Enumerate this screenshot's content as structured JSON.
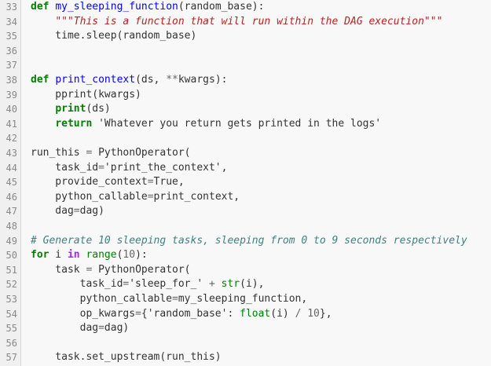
{
  "editor": {
    "lines": [
      {
        "num": "33",
        "tokens": [
          {
            "t": "k",
            "v": "def"
          },
          {
            "t": "t",
            "v": " "
          },
          {
            "t": "nf",
            "v": "my_sleeping_function"
          },
          {
            "t": "t",
            "v": "(random_base):"
          }
        ]
      },
      {
        "num": "34",
        "tokens": [
          {
            "t": "t",
            "v": "    "
          },
          {
            "t": "sd",
            "v": "\"\"\"This is a function that will run within the DAG execution\"\"\""
          }
        ]
      },
      {
        "num": "35",
        "tokens": [
          {
            "t": "t",
            "v": "    time.sleep(random_base)"
          }
        ]
      },
      {
        "num": "36",
        "tokens": []
      },
      {
        "num": "37",
        "tokens": []
      },
      {
        "num": "38",
        "tokens": [
          {
            "t": "k",
            "v": "def"
          },
          {
            "t": "t",
            "v": " "
          },
          {
            "t": "nf",
            "v": "print_context"
          },
          {
            "t": "t",
            "v": "(ds, "
          },
          {
            "t": "o",
            "v": "**"
          },
          {
            "t": "t",
            "v": "kwargs):"
          }
        ]
      },
      {
        "num": "39",
        "tokens": [
          {
            "t": "t",
            "v": "    pprint(kwargs)"
          }
        ]
      },
      {
        "num": "40",
        "tokens": [
          {
            "t": "t",
            "v": "    "
          },
          {
            "t": "k",
            "v": "print"
          },
          {
            "t": "t",
            "v": "(ds)"
          }
        ]
      },
      {
        "num": "41",
        "tokens": [
          {
            "t": "t",
            "v": "    "
          },
          {
            "t": "k",
            "v": "return"
          },
          {
            "t": "t",
            "v": " 'Whatever you return gets printed in the logs'"
          }
        ]
      },
      {
        "num": "42",
        "tokens": []
      },
      {
        "num": "43",
        "tokens": [
          {
            "t": "t",
            "v": "run_this "
          },
          {
            "t": "o",
            "v": "="
          },
          {
            "t": "t",
            "v": " PythonOperator("
          }
        ]
      },
      {
        "num": "44",
        "tokens": [
          {
            "t": "t",
            "v": "    task_id"
          },
          {
            "t": "o",
            "v": "="
          },
          {
            "t": "t",
            "v": "'print_the_context',"
          }
        ]
      },
      {
        "num": "45",
        "tokens": [
          {
            "t": "t",
            "v": "    provide_context"
          },
          {
            "t": "o",
            "v": "="
          },
          {
            "t": "t",
            "v": "True,"
          }
        ]
      },
      {
        "num": "46",
        "tokens": [
          {
            "t": "t",
            "v": "    python_callable"
          },
          {
            "t": "o",
            "v": "="
          },
          {
            "t": "t",
            "v": "print_context,"
          }
        ]
      },
      {
        "num": "47",
        "tokens": [
          {
            "t": "t",
            "v": "    dag"
          },
          {
            "t": "o",
            "v": "="
          },
          {
            "t": "t",
            "v": "dag)"
          }
        ]
      },
      {
        "num": "48",
        "tokens": []
      },
      {
        "num": "49",
        "tokens": [
          {
            "t": "c",
            "v": "# Generate 10 sleeping tasks, sleeping from 0 to 9 seconds respectively"
          }
        ]
      },
      {
        "num": "50",
        "tokens": [
          {
            "t": "k",
            "v": "for"
          },
          {
            "t": "t",
            "v": " i "
          },
          {
            "t": "ow",
            "v": "in"
          },
          {
            "t": "t",
            "v": " "
          },
          {
            "t": "nb",
            "v": "range"
          },
          {
            "t": "t",
            "v": "("
          },
          {
            "t": "m",
            "v": "10"
          },
          {
            "t": "t",
            "v": "):"
          }
        ]
      },
      {
        "num": "51",
        "tokens": [
          {
            "t": "t",
            "v": "    task "
          },
          {
            "t": "o",
            "v": "="
          },
          {
            "t": "t",
            "v": " PythonOperator("
          }
        ]
      },
      {
        "num": "52",
        "tokens": [
          {
            "t": "t",
            "v": "        task_id"
          },
          {
            "t": "o",
            "v": "="
          },
          {
            "t": "t",
            "v": "'sleep_for_' "
          },
          {
            "t": "o",
            "v": "+"
          },
          {
            "t": "t",
            "v": " "
          },
          {
            "t": "nb",
            "v": "str"
          },
          {
            "t": "t",
            "v": "(i),"
          }
        ]
      },
      {
        "num": "53",
        "tokens": [
          {
            "t": "t",
            "v": "        python_callable"
          },
          {
            "t": "o",
            "v": "="
          },
          {
            "t": "t",
            "v": "my_sleeping_function,"
          }
        ]
      },
      {
        "num": "54",
        "tokens": [
          {
            "t": "t",
            "v": "        op_kwargs"
          },
          {
            "t": "o",
            "v": "="
          },
          {
            "t": "t",
            "v": "{'random_base': "
          },
          {
            "t": "nb",
            "v": "float"
          },
          {
            "t": "t",
            "v": "(i) "
          },
          {
            "t": "o",
            "v": "/"
          },
          {
            "t": "t",
            "v": " "
          },
          {
            "t": "m",
            "v": "10"
          },
          {
            "t": "t",
            "v": "},"
          }
        ]
      },
      {
        "num": "55",
        "tokens": [
          {
            "t": "t",
            "v": "        dag"
          },
          {
            "t": "o",
            "v": "="
          },
          {
            "t": "t",
            "v": "dag)"
          }
        ]
      },
      {
        "num": "56",
        "tokens": []
      },
      {
        "num": "57",
        "tokens": [
          {
            "t": "t",
            "v": "    task.set_upstream(run_this)"
          }
        ]
      }
    ]
  },
  "colors": {
    "keyword": "#008000",
    "function_name": "#0000ff",
    "string": "#ba2121",
    "comment": "#408080",
    "builtin": "#008000",
    "operator_word": "#aa22ff",
    "number": "#666666",
    "line_number": "#888888",
    "background": "#f8f8f8"
  }
}
